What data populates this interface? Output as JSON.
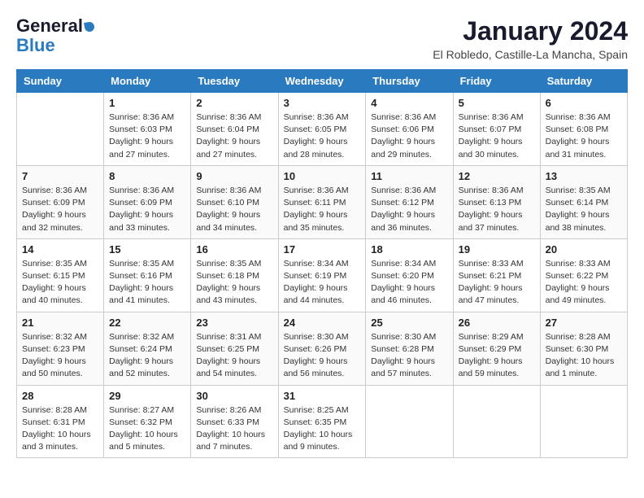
{
  "header": {
    "logo_line1": "General",
    "logo_line2": "Blue",
    "title": "January 2024",
    "subtitle": "El Robledo, Castille-La Mancha, Spain"
  },
  "days_of_week": [
    "Sunday",
    "Monday",
    "Tuesday",
    "Wednesday",
    "Thursday",
    "Friday",
    "Saturday"
  ],
  "weeks": [
    [
      {
        "day": "",
        "info": ""
      },
      {
        "day": "1",
        "info": "Sunrise: 8:36 AM\nSunset: 6:03 PM\nDaylight: 9 hours\nand 27 minutes."
      },
      {
        "day": "2",
        "info": "Sunrise: 8:36 AM\nSunset: 6:04 PM\nDaylight: 9 hours\nand 27 minutes."
      },
      {
        "day": "3",
        "info": "Sunrise: 8:36 AM\nSunset: 6:05 PM\nDaylight: 9 hours\nand 28 minutes."
      },
      {
        "day": "4",
        "info": "Sunrise: 8:36 AM\nSunset: 6:06 PM\nDaylight: 9 hours\nand 29 minutes."
      },
      {
        "day": "5",
        "info": "Sunrise: 8:36 AM\nSunset: 6:07 PM\nDaylight: 9 hours\nand 30 minutes."
      },
      {
        "day": "6",
        "info": "Sunrise: 8:36 AM\nSunset: 6:08 PM\nDaylight: 9 hours\nand 31 minutes."
      }
    ],
    [
      {
        "day": "7",
        "info": ""
      },
      {
        "day": "8",
        "info": "Sunrise: 8:36 AM\nSunset: 6:09 PM\nDaylight: 9 hours\nand 33 minutes."
      },
      {
        "day": "9",
        "info": "Sunrise: 8:36 AM\nSunset: 6:10 PM\nDaylight: 9 hours\nand 34 minutes."
      },
      {
        "day": "10",
        "info": "Sunrise: 8:36 AM\nSunset: 6:11 PM\nDaylight: 9 hours\nand 35 minutes."
      },
      {
        "day": "11",
        "info": "Sunrise: 8:36 AM\nSunset: 6:12 PM\nDaylight: 9 hours\nand 36 minutes."
      },
      {
        "day": "12",
        "info": "Sunrise: 8:36 AM\nSunset: 6:13 PM\nDaylight: 9 hours\nand 37 minutes."
      },
      {
        "day": "13",
        "info": "Sunrise: 8:35 AM\nSunset: 6:14 PM\nDaylight: 9 hours\nand 38 minutes."
      }
    ],
    [
      {
        "day": "14",
        "info": ""
      },
      {
        "day": "15",
        "info": "Sunrise: 8:35 AM\nSunset: 6:16 PM\nDaylight: 9 hours\nand 41 minutes."
      },
      {
        "day": "16",
        "info": "Sunrise: 8:35 AM\nSunset: 6:18 PM\nDaylight: 9 hours\nand 43 minutes."
      },
      {
        "day": "17",
        "info": "Sunrise: 8:34 AM\nSunset: 6:19 PM\nDaylight: 9 hours\nand 44 minutes."
      },
      {
        "day": "18",
        "info": "Sunrise: 8:34 AM\nSunset: 6:20 PM\nDaylight: 9 hours\nand 46 minutes."
      },
      {
        "day": "19",
        "info": "Sunrise: 8:33 AM\nSunset: 6:21 PM\nDaylight: 9 hours\nand 47 minutes."
      },
      {
        "day": "20",
        "info": "Sunrise: 8:33 AM\nSunset: 6:22 PM\nDaylight: 9 hours\nand 49 minutes."
      }
    ],
    [
      {
        "day": "21",
        "info": ""
      },
      {
        "day": "22",
        "info": "Sunrise: 8:32 AM\nSunset: 6:24 PM\nDaylight: 9 hours\nand 52 minutes."
      },
      {
        "day": "23",
        "info": "Sunrise: 8:31 AM\nSunset: 6:25 PM\nDaylight: 9 hours\nand 54 minutes."
      },
      {
        "day": "24",
        "info": "Sunrise: 8:30 AM\nSunset: 6:26 PM\nDaylight: 9 hours\nand 56 minutes."
      },
      {
        "day": "25",
        "info": "Sunrise: 8:30 AM\nSunset: 6:28 PM\nDaylight: 9 hours\nand 57 minutes."
      },
      {
        "day": "26",
        "info": "Sunrise: 8:29 AM\nSunset: 6:29 PM\nDaylight: 9 hours\nand 59 minutes."
      },
      {
        "day": "27",
        "info": "Sunrise: 8:28 AM\nSunset: 6:30 PM\nDaylight: 10 hours\nand 1 minute."
      }
    ],
    [
      {
        "day": "28",
        "info": "Sunrise: 8:28 AM\nSunset: 6:31 PM\nDaylight: 10 hours\nand 3 minutes."
      },
      {
        "day": "29",
        "info": "Sunrise: 8:27 AM\nSunset: 6:32 PM\nDaylight: 10 hours\nand 5 minutes."
      },
      {
        "day": "30",
        "info": "Sunrise: 8:26 AM\nSunset: 6:33 PM\nDaylight: 10 hours\nand 7 minutes."
      },
      {
        "day": "31",
        "info": "Sunrise: 8:25 AM\nSunset: 6:35 PM\nDaylight: 10 hours\nand 9 minutes."
      },
      {
        "day": "",
        "info": ""
      },
      {
        "day": "",
        "info": ""
      },
      {
        "day": "",
        "info": ""
      }
    ]
  ],
  "week0_day7_info": "Sunrise: 8:36 AM\nSunset: 6:09 PM\nDaylight: 9 hours\nand 32 minutes.",
  "week2_day14_info": "Sunrise: 8:35 AM\nSunset: 6:15 PM\nDaylight: 9 hours\nand 40 minutes.",
  "week3_day21_info": "Sunrise: 8:32 AM\nSunset: 6:23 PM\nDaylight: 9 hours\nand 50 minutes."
}
